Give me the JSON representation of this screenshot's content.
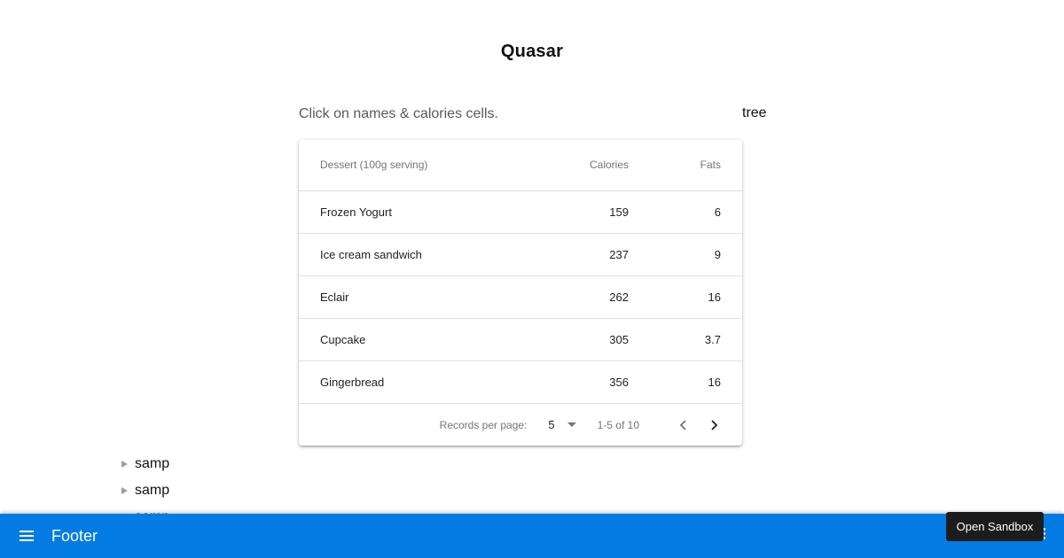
{
  "page": {
    "title": "Quasar",
    "instructions": "Click on names & calories cells.",
    "tree_label": "tree"
  },
  "table": {
    "columns": [
      "Dessert (100g serving)",
      "Calories",
      "Fats"
    ],
    "rows": [
      [
        "Frozen Yogurt",
        "159",
        "6"
      ],
      [
        "Ice cream sandwich",
        "237",
        "9"
      ],
      [
        "Eclair",
        "262",
        "16"
      ],
      [
        "Cupcake",
        "305",
        "3.7"
      ],
      [
        "Gingerbread",
        "356",
        "16"
      ]
    ],
    "footer": {
      "records_per_page_label": "Records per page:",
      "records_per_page_value": "5",
      "range": "1-5 of 10"
    }
  },
  "tree": {
    "nodes": [
      "samp",
      "samp",
      "samp"
    ]
  },
  "footer_bar": {
    "title": "Footer",
    "menu_icon": "menu-icon",
    "more_icon": "more-vert-icon"
  },
  "sandbox": {
    "label": "Open Sandbox"
  },
  "colors": {
    "primary": "#027be3",
    "tooltip": "#1c1c1c"
  }
}
